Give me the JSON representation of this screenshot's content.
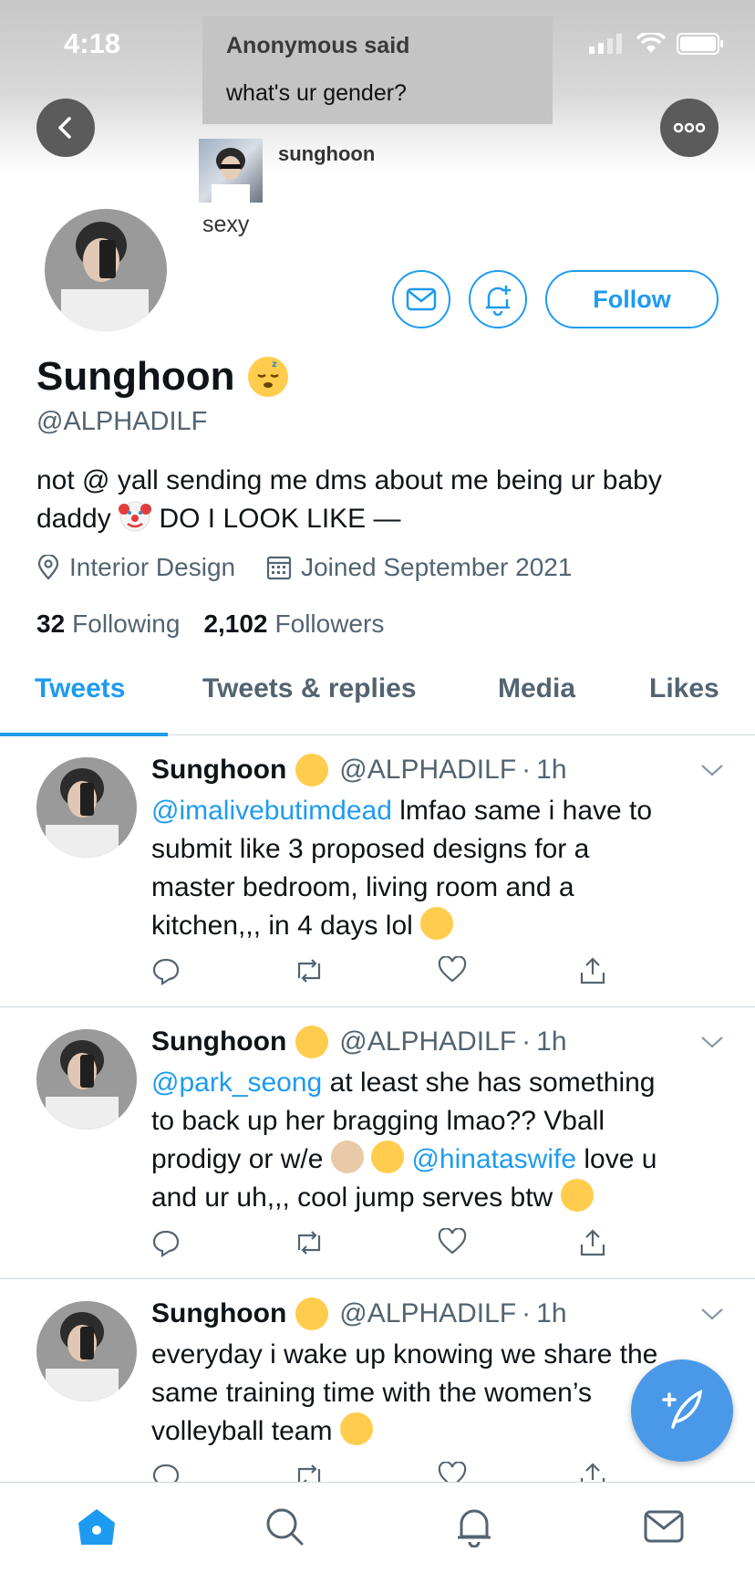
{
  "status_bar": {
    "time": "4:18"
  },
  "anon_question": {
    "sender": "Anonymous said",
    "question": "what's ur gender?"
  },
  "reply_preview": {
    "name": "sunghoon",
    "text": "sexy"
  },
  "profile": {
    "follow_label": "Follow",
    "display_name": "Sunghoon",
    "handle": "@ALPHADILF",
    "bio_line1": "not @ yall sending me dms about me being ur baby",
    "bio_line2a": "daddy",
    "bio_line2b": "DO I LOOK LIKE —",
    "location": "Interior Design",
    "joined": "Joined September 2021",
    "following_count": "32",
    "following_label": "Following",
    "followers_count": "2,102",
    "followers_label": "Followers"
  },
  "tabs": [
    {
      "label": "Tweets",
      "active": true
    },
    {
      "label": "Tweets & replies",
      "active": false
    },
    {
      "label": "Media",
      "active": false
    },
    {
      "label": "Likes",
      "active": false
    }
  ],
  "tweets": [
    {
      "name": "Sunghoon",
      "handle": "@ALPHADILF",
      "time": "1h",
      "mention1": "@imalivebutimdead",
      "text_a": "lmfao same i have to",
      "text_b": "submit like 3 proposed designs for a",
      "text_c": "master bedroom, living room and a",
      "text_d": "kitchen,,, in 4 days lol"
    },
    {
      "name": "Sunghoon",
      "handle": "@ALPHADILF",
      "time": "1h",
      "mention1": "@park_seong",
      "text_a": "at least she has something",
      "text_b": "to back up her bragging lmao?? Vball",
      "text_c": "prodigy or w/e",
      "mention2": "@hinataswife",
      "text_d": "love u",
      "text_e": "and ur uh,,, cool jump serves btw"
    },
    {
      "name": "Sunghoon",
      "handle": "@ALPHADILF",
      "time": "1h",
      "text_a": "everyday i wake up knowing we share the",
      "text_b": "same training time with the women’s",
      "text_c": "volleyball team"
    }
  ],
  "colors": {
    "accent": "#1d9bf0",
    "secondary_text": "#536471",
    "divider": "#cfd9de",
    "fab": "#4a99e9"
  },
  "icons": [
    "back-arrow-icon",
    "more-options-icon",
    "message-icon",
    "notification-bell-icon",
    "location-pin-icon",
    "calendar-icon",
    "reply-icon",
    "retweet-icon",
    "like-icon",
    "share-icon",
    "chevron-down-icon",
    "compose-icon",
    "home-icon",
    "search-icon",
    "notifications-icon",
    "messages-icon"
  ]
}
